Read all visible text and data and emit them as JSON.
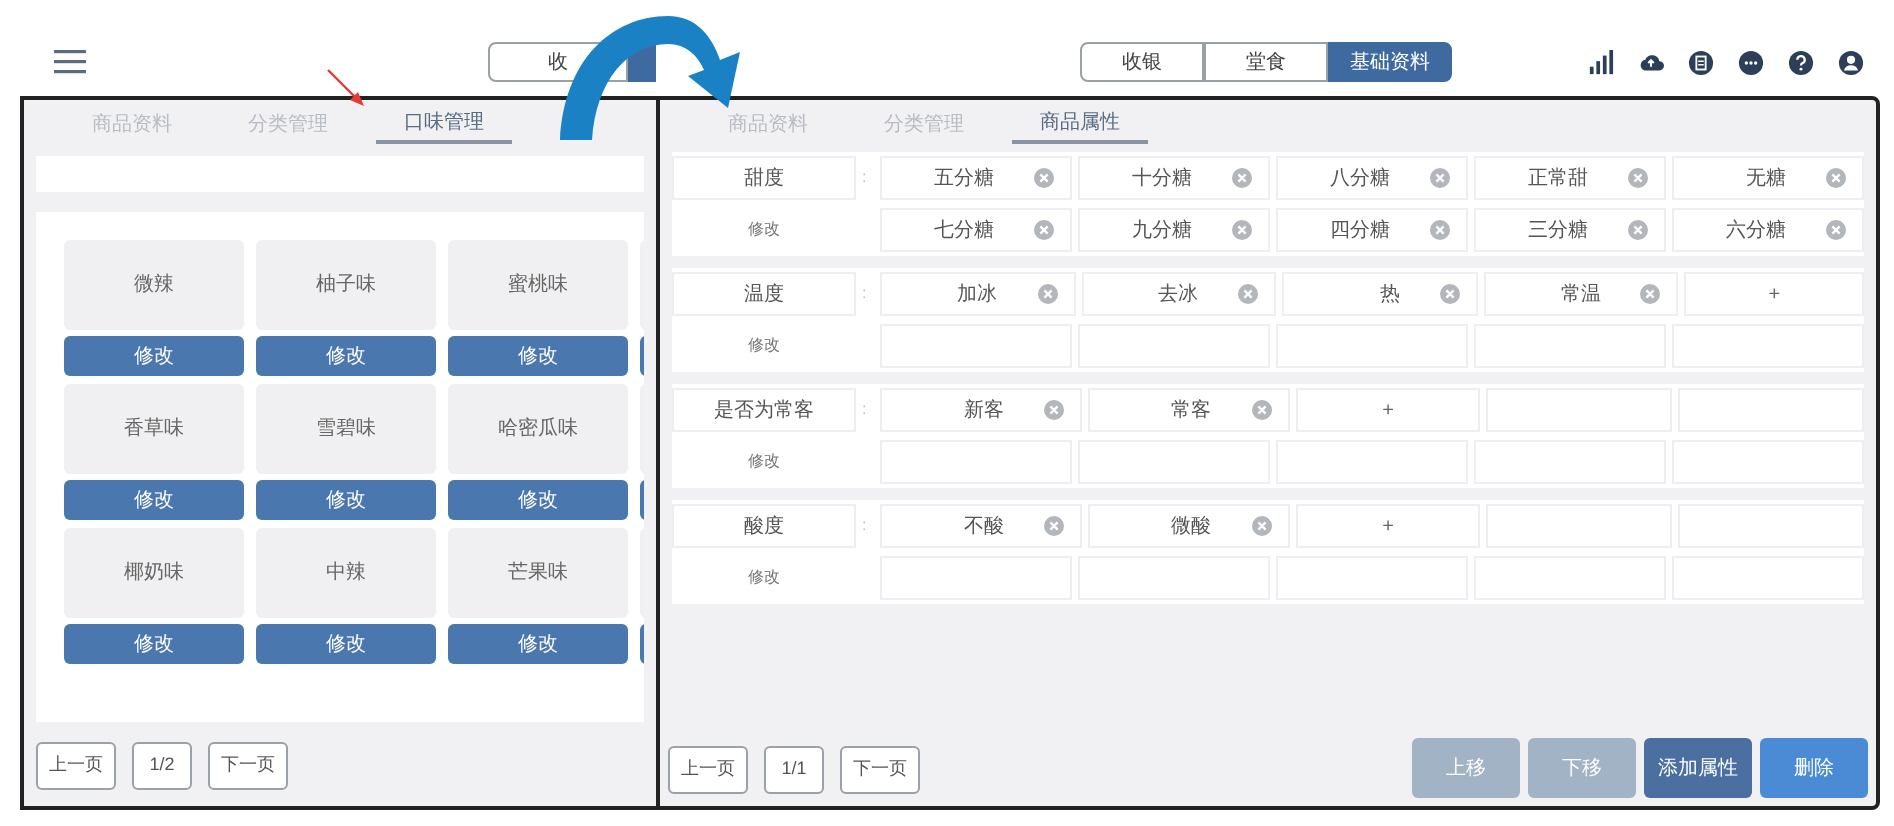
{
  "left": {
    "segment": "收",
    "tabs": [
      {
        "label": "商品资料",
        "selected": false
      },
      {
        "label": "分类管理",
        "selected": false
      },
      {
        "label": "口味管理",
        "selected": true
      }
    ],
    "flavors": [
      {
        "name": "微辣",
        "button": "修改"
      },
      {
        "name": "柚子味",
        "button": "修改"
      },
      {
        "name": "蜜桃味",
        "button": "修改"
      },
      {
        "name": "香草味",
        "button": "修改"
      },
      {
        "name": "雪碧味",
        "button": "修改"
      },
      {
        "name": "哈密瓜味",
        "button": "修改"
      },
      {
        "name": "椰奶味",
        "button": "修改"
      },
      {
        "name": "中辣",
        "button": "修改"
      },
      {
        "name": "芒果味",
        "button": "修改"
      }
    ],
    "pager": {
      "prev": "上一页",
      "page": "1/2",
      "next": "下一页"
    }
  },
  "right": {
    "segments": [
      {
        "label": "收银",
        "selected": false
      },
      {
        "label": "堂食",
        "selected": false
      },
      {
        "label": "基础资料",
        "selected": true
      }
    ],
    "tabs": [
      {
        "label": "商品资料",
        "selected": false
      },
      {
        "label": "分类管理",
        "selected": false
      },
      {
        "label": "商品属性",
        "selected": true
      }
    ],
    "attributes": [
      {
        "name": "甜度",
        "separator": ":",
        "edit": "修改",
        "rows": [
          [
            {
              "kind": "option",
              "label": "五分糖"
            },
            {
              "kind": "option",
              "label": "十分糖"
            },
            {
              "kind": "option",
              "label": "八分糖"
            },
            {
              "kind": "option",
              "label": "正常甜"
            },
            {
              "kind": "option",
              "label": "无糖"
            }
          ],
          [
            {
              "kind": "option",
              "label": "七分糖"
            },
            {
              "kind": "option",
              "label": "九分糖"
            },
            {
              "kind": "option",
              "label": "四分糖"
            },
            {
              "kind": "option",
              "label": "三分糖"
            },
            {
              "kind": "option",
              "label": "六分糖"
            }
          ]
        ]
      },
      {
        "name": "温度",
        "separator": ":",
        "edit": "修改",
        "rows": [
          [
            {
              "kind": "option",
              "label": "加冰"
            },
            {
              "kind": "option",
              "label": "去冰"
            },
            {
              "kind": "option",
              "label": "热"
            },
            {
              "kind": "option",
              "label": "常温"
            },
            {
              "kind": "add",
              "label": "+"
            }
          ],
          [
            {
              "kind": "empty"
            },
            {
              "kind": "empty"
            },
            {
              "kind": "empty"
            },
            {
              "kind": "empty"
            },
            {
              "kind": "empty"
            }
          ]
        ]
      },
      {
        "name": "是否为常客",
        "separator": ":",
        "edit": "修改",
        "rows": [
          [
            {
              "kind": "option",
              "label": "新客"
            },
            {
              "kind": "option",
              "label": "常客"
            },
            {
              "kind": "add",
              "label": "+"
            },
            {
              "kind": "empty"
            },
            {
              "kind": "empty"
            }
          ],
          [
            {
              "kind": "empty"
            },
            {
              "kind": "empty"
            },
            {
              "kind": "empty"
            },
            {
              "kind": "empty"
            },
            {
              "kind": "empty"
            }
          ]
        ]
      },
      {
        "name": "酸度",
        "separator": ":",
        "edit": "修改",
        "rows": [
          [
            {
              "kind": "option",
              "label": "不酸"
            },
            {
              "kind": "option",
              "label": "微酸"
            },
            {
              "kind": "add",
              "label": "+"
            },
            {
              "kind": "empty"
            },
            {
              "kind": "empty"
            }
          ],
          [
            {
              "kind": "empty"
            },
            {
              "kind": "empty"
            },
            {
              "kind": "empty"
            },
            {
              "kind": "empty"
            },
            {
              "kind": "empty"
            }
          ]
        ]
      }
    ],
    "pager": {
      "prev": "上一页",
      "page": "1/1",
      "next": "下一页"
    },
    "actions": [
      {
        "label": "上移",
        "kind": "move",
        "disabled": true
      },
      {
        "label": "下移",
        "kind": "move",
        "disabled": true
      },
      {
        "label": "添加属性",
        "kind": "add",
        "disabled": false
      },
      {
        "label": "删除",
        "kind": "delete",
        "disabled": false
      }
    ]
  }
}
